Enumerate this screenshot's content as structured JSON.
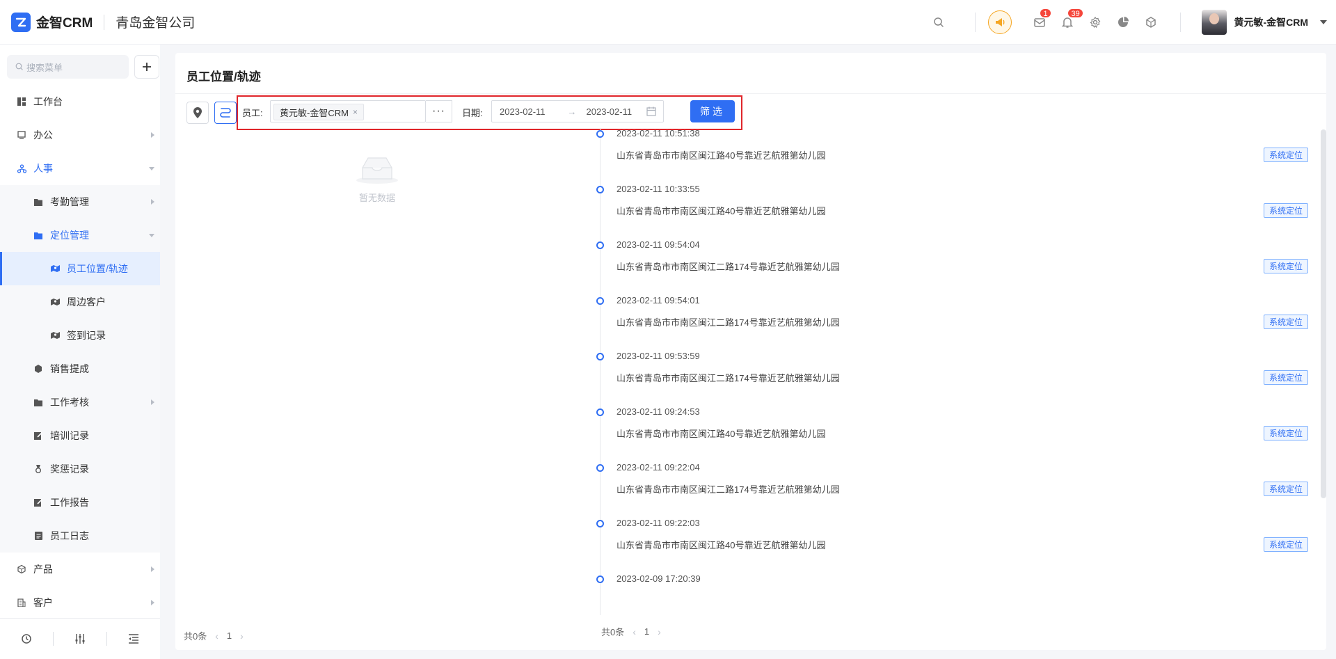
{
  "header": {
    "app_name": "金智CRM",
    "company": "青岛金智公司",
    "notifications": {
      "mail_count": "1",
      "bell_count": "39"
    },
    "user_name": "黄元敏-金智CRM",
    "icons": [
      "search-icon",
      "announcement-icon",
      "mail-icon",
      "bell-icon",
      "gear-icon",
      "pie-chart-icon",
      "cube-icon",
      "chevron-down-icon"
    ]
  },
  "sidebar": {
    "search_placeholder": "搜索菜单",
    "items": [
      {
        "label": "工作台"
      },
      {
        "label": "办公"
      },
      {
        "label": "人事"
      },
      {
        "label": "考勤管理"
      },
      {
        "label": "定位管理"
      },
      {
        "label": "员工位置/轨迹"
      },
      {
        "label": "周边客户"
      },
      {
        "label": "签到记录"
      },
      {
        "label": "销售提成"
      },
      {
        "label": "工作考核"
      },
      {
        "label": "培训记录"
      },
      {
        "label": "奖惩记录"
      },
      {
        "label": "工作报告"
      },
      {
        "label": "员工日志"
      },
      {
        "label": "产品"
      },
      {
        "label": "客户"
      }
    ]
  },
  "main": {
    "title": "员工位置/轨迹",
    "filter": {
      "employee_label": "员工:",
      "employee_tag": "黄元敏-金智CRM",
      "more": "···",
      "date_label": "日期:",
      "date_start": "2023-02-11",
      "date_end": "2023-02-11",
      "button": "筛选"
    },
    "empty_text": "暂无数据",
    "left_footer": {
      "total": "共0条",
      "page": "1"
    },
    "right_footer": {
      "total": "共0条",
      "page": "1"
    },
    "timeline": [
      {
        "time": "2023-02-11 10:51:38",
        "address": "山东省青岛市市南区闽江路40号靠近艺航雅第幼儿园",
        "tag": "系统定位"
      },
      {
        "time": "2023-02-11 10:33:55",
        "address": "山东省青岛市市南区闽江路40号靠近艺航雅第幼儿园",
        "tag": "系统定位"
      },
      {
        "time": "2023-02-11 09:54:04",
        "address": "山东省青岛市市南区闽江二路174号靠近艺航雅第幼儿园",
        "tag": "系统定位"
      },
      {
        "time": "2023-02-11 09:54:01",
        "address": "山东省青岛市市南区闽江二路174号靠近艺航雅第幼儿园",
        "tag": "系统定位"
      },
      {
        "time": "2023-02-11 09:53:59",
        "address": "山东省青岛市市南区闽江二路174号靠近艺航雅第幼儿园",
        "tag": "系统定位"
      },
      {
        "time": "2023-02-11 09:24:53",
        "address": "山东省青岛市市南区闽江路40号靠近艺航雅第幼儿园",
        "tag": "系统定位"
      },
      {
        "time": "2023-02-11 09:22:04",
        "address": "山东省青岛市市南区闽江二路174号靠近艺航雅第幼儿园",
        "tag": "系统定位"
      },
      {
        "time": "2023-02-11 09:22:03",
        "address": "山东省青岛市市南区闽江路40号靠近艺航雅第幼儿园",
        "tag": "系统定位"
      },
      {
        "time": "2023-02-09 17:20:39",
        "address": "",
        "tag": ""
      }
    ]
  },
  "colors": {
    "accent": "#2f6ef3",
    "highlight": "#e0262b",
    "badge": "#f5463b",
    "announce": "#f5a623"
  }
}
